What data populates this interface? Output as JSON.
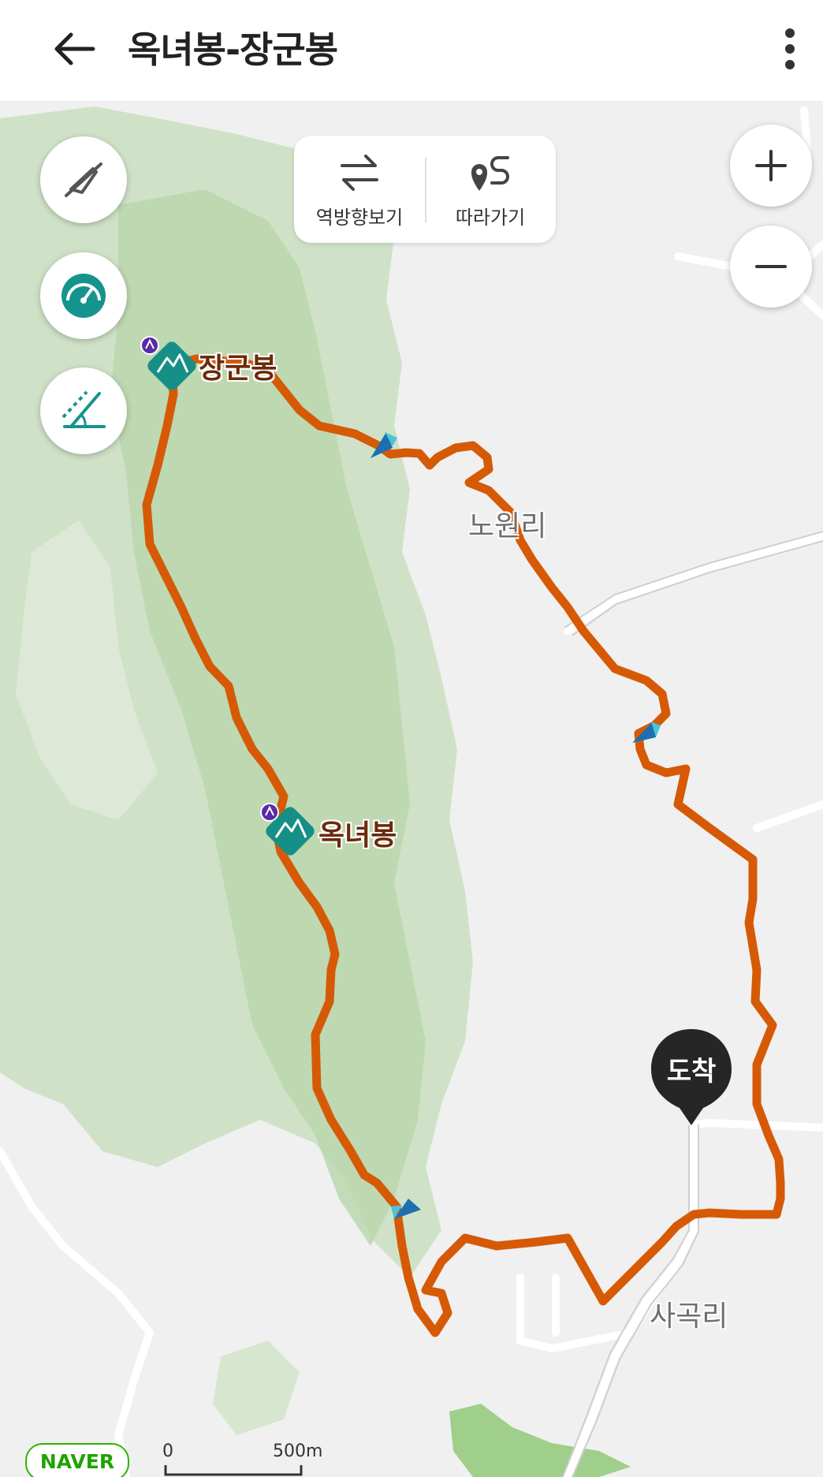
{
  "header": {
    "title": "옥녀봉-장군봉"
  },
  "toolbar": {
    "reverse_label": "역방향보기",
    "follow_label": "따라가기"
  },
  "map": {
    "peaks": [
      {
        "name": "장군봉"
      },
      {
        "name": "옥녀봉"
      }
    ],
    "places": [
      {
        "name": "노원리"
      },
      {
        "name": "사곡리"
      }
    ],
    "arrival_label": "도착",
    "scale": {
      "zero": "0",
      "max": "500m"
    },
    "logo_text": "NAVER"
  },
  "icons": {
    "back": "arrow-left-icon",
    "more": "vertical-dots-icon",
    "compass_off": "compass-off-icon",
    "speedometer": "speedometer-icon",
    "slope": "slope-angle-icon",
    "reverse": "swap-arrows-icon",
    "follow": "route-follow-icon",
    "zoom_in": "plus-icon",
    "zoom_out": "minus-icon",
    "peak": "mountain-marker-icon"
  },
  "colors": {
    "route": "#d95f0a",
    "accent": "#15948d",
    "forest": "#c9dfc0",
    "road": "#ffffff",
    "peak_label": "#6b2a0a",
    "arrival_marker": "#262626"
  }
}
